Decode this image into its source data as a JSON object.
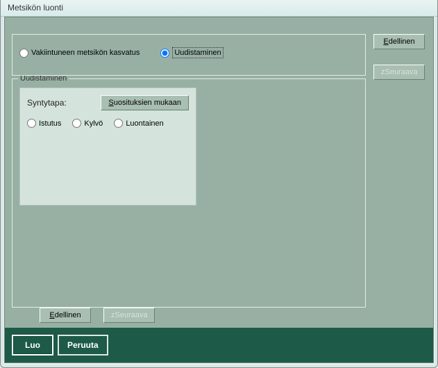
{
  "window": {
    "title": "Metsikön luonti"
  },
  "main": {
    "options": {
      "established": {
        "label": "Vakiintuneen metsikön kasvatus",
        "selected": false
      },
      "regeneration": {
        "label": "Uudistaminen",
        "selected": true
      }
    },
    "fieldset_legend": "Uudistaminen",
    "sub_panel": {
      "syntytapa_label": "Syntytapa:",
      "suositus_button": "Suosituksien mukaan",
      "options": {
        "istutus": {
          "label": "Istutus"
        },
        "kylvo": {
          "label": "Kylvö"
        },
        "luontainen": {
          "label": "Luontainen"
        }
      }
    }
  },
  "nav": {
    "prev_prefix": "E",
    "prev_rest": "dellinen",
    "next_prefix": "S",
    "next_rest": "euraava",
    "next_full": "zSeuraava"
  },
  "footer": {
    "create": "Luo",
    "cancel": "Peruuta"
  }
}
